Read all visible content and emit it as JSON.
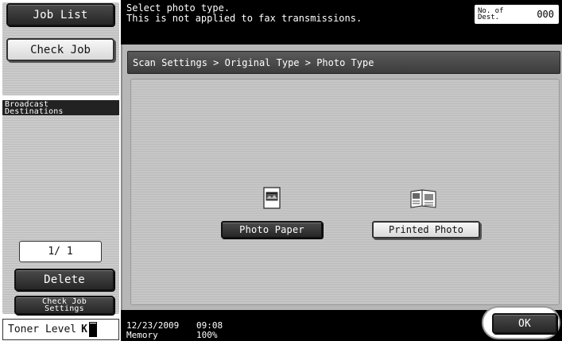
{
  "left_panel": {
    "job_list_label": "Job List",
    "check_job_label": "Check Job",
    "broadcast_destinations_label": "Broadcast\nDestinations",
    "page_counter": "1/  1",
    "delete_label": "Delete",
    "check_job_settings_label": "Check Job\nSettings",
    "toner": {
      "label": "Toner Level",
      "color": "K",
      "level": 0.95
    }
  },
  "message": {
    "line1": "Select photo type.",
    "line2": "This is not applied to fax transmissions.",
    "dest_label": "No. of\nDest.",
    "dest_count": "000"
  },
  "breadcrumb": "Scan Settings > Original Type > Photo Type",
  "options": [
    {
      "label": "Photo Paper",
      "icon": "photo-paper-icon",
      "selected": true
    },
    {
      "label": "Printed Photo",
      "icon": "printed-photo-icon",
      "selected": false
    }
  ],
  "status": {
    "date": "12/23/2009",
    "time": "09:08",
    "memory_label": "Memory",
    "memory_value": "100%"
  },
  "ok_label": "OK"
}
